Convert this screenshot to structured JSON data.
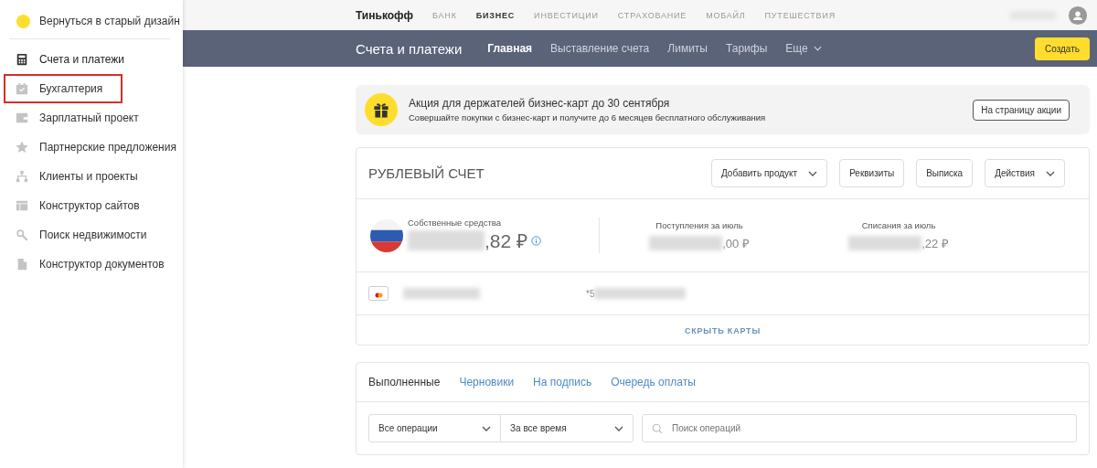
{
  "sidebar": {
    "back_link": {
      "label": "Вернуться в старый дизайн"
    },
    "items": [
      {
        "label": "Счета и платежи",
        "selected": true,
        "highlighted": false
      },
      {
        "label": "Бухгалтерия",
        "selected": false,
        "highlighted": true
      },
      {
        "label": "Зарплатный проект",
        "selected": false,
        "highlighted": false
      },
      {
        "label": "Партнерские предложения",
        "selected": false,
        "highlighted": false
      },
      {
        "label": "Клиенты и проекты",
        "selected": false,
        "highlighted": false
      },
      {
        "label": "Конструктор сайтов",
        "selected": false,
        "highlighted": false
      },
      {
        "label": "Поиск недвижимости",
        "selected": false,
        "highlighted": false
      },
      {
        "label": "Конструктор документов",
        "selected": false,
        "highlighted": false
      }
    ]
  },
  "top_nav": {
    "brand": "Тинькофф",
    "links": [
      {
        "label": "БАНК",
        "selected": false
      },
      {
        "label": "БИЗНЕС",
        "selected": true
      },
      {
        "label": "ИНВЕСТИЦИИ",
        "selected": false
      },
      {
        "label": "СТРАХОВАНИЕ",
        "selected": false
      },
      {
        "label": "МОБАЙЛ",
        "selected": false
      },
      {
        "label": "ПУТЕШЕСТВИЯ",
        "selected": false
      }
    ]
  },
  "section_bar": {
    "title": "Счета и платежи",
    "tabs": [
      {
        "label": "Главная",
        "selected": true
      },
      {
        "label": "Выставление счета",
        "selected": false
      },
      {
        "label": "Лимиты",
        "selected": false
      },
      {
        "label": "Тарифы",
        "selected": false
      }
    ],
    "more": "Еще",
    "create_button": "Создать"
  },
  "promo": {
    "title": "Акция для держателей бизнес-карт до 30 сентября",
    "text": "Совершайте покупки с бизнес-карт и получите до 6 месяцев бесплатного обслуживания",
    "button": "На страницу акции"
  },
  "account": {
    "title": "РУБЛЕВЫЙ СЧЕТ",
    "actions": [
      {
        "label": "Добавить продукт",
        "dropdown": true
      },
      {
        "label": "Реквизиты",
        "dropdown": false
      },
      {
        "label": "Выписка",
        "dropdown": false
      },
      {
        "label": "Действия",
        "dropdown": true
      }
    ],
    "balance": {
      "label": "Собственные средства",
      "amount_tail": ",82 ₽"
    },
    "stats": [
      {
        "label": "Поступления за июль",
        "amount_tail": ",00 ₽"
      },
      {
        "label": "Списания за июль",
        "amount_tail": ",22 ₽"
      }
    ],
    "card": {
      "number_prefix": "*5"
    },
    "hide_cards": "СКРЫТЬ КАРТЫ"
  },
  "operations": {
    "tabs": [
      {
        "label": "Выполненные",
        "selected": true
      },
      {
        "label": "Черновики",
        "selected": false
      },
      {
        "label": "На подпись",
        "selected": false
      },
      {
        "label": "Очередь оплаты",
        "selected": false
      }
    ],
    "filters": [
      "Все операции",
      "За все время"
    ],
    "search": {
      "placeholder": "Поиск операций"
    }
  }
}
